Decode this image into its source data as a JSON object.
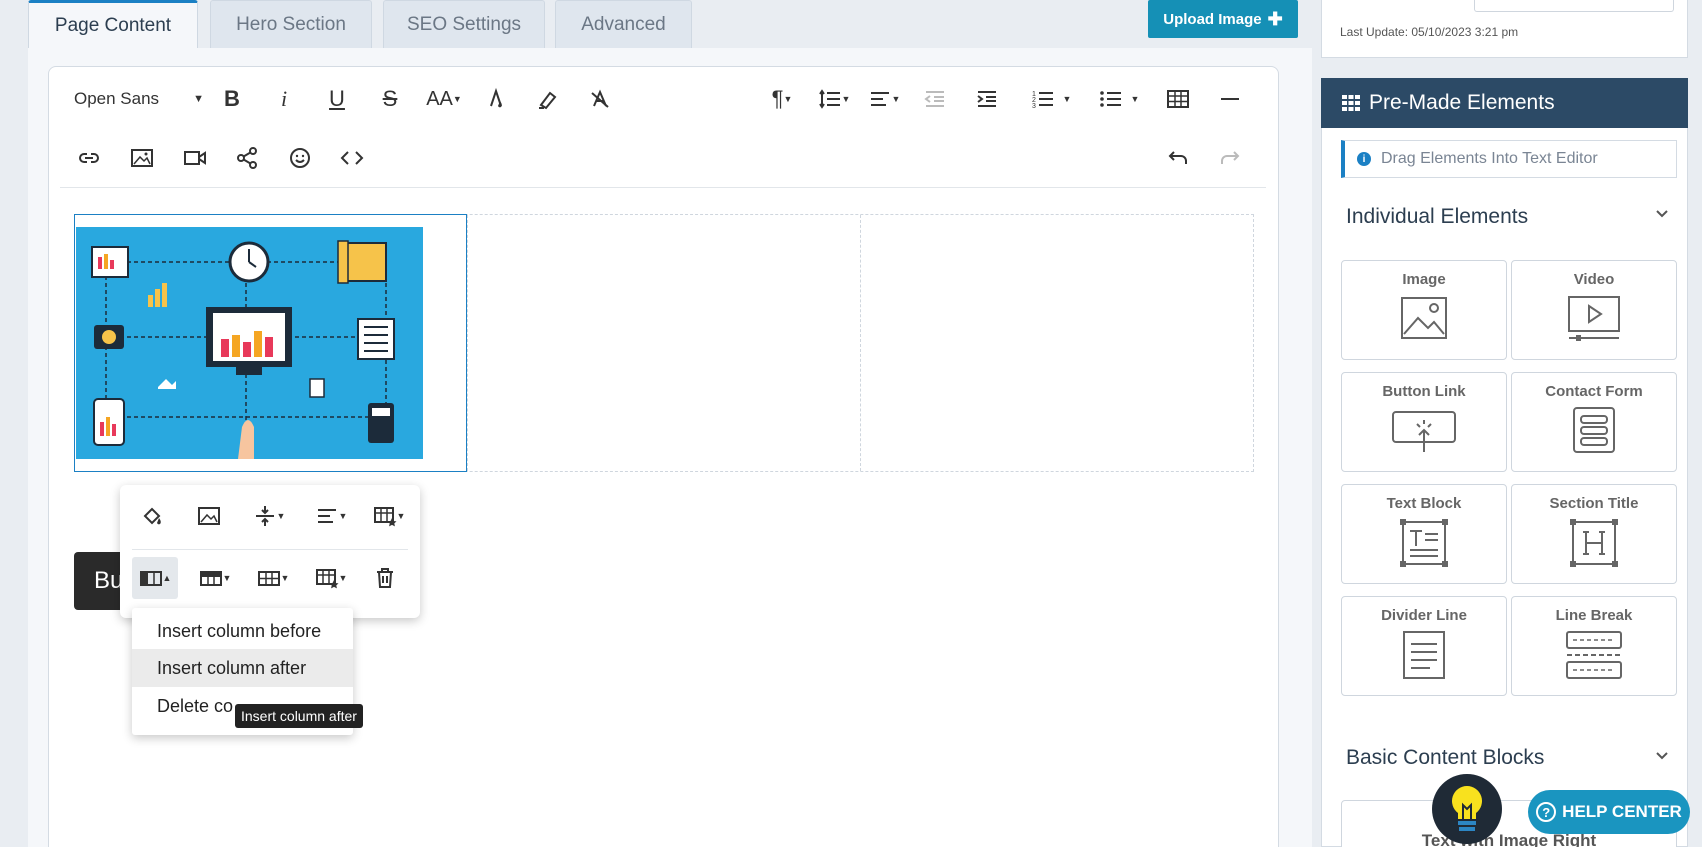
{
  "tabs": [
    {
      "label": "Page Content",
      "active": true
    },
    {
      "label": "Hero Section",
      "active": false
    },
    {
      "label": "SEO Settings",
      "active": false
    },
    {
      "label": "Advanced",
      "active": false
    }
  ],
  "upload_button": {
    "label": "Upload Image",
    "icon": "plus-icon"
  },
  "toolbar": {
    "font_family": "Open Sans",
    "aa_label": "AA"
  },
  "content": {
    "button_partial_text": "Bu"
  },
  "table_popup": {
    "dropdown_items": [
      "Insert column before",
      "Insert column after",
      "Delete co"
    ],
    "hovered_item": "Insert column after",
    "tooltip": "Insert column after"
  },
  "sidebar": {
    "last_update": "Last Update: 05/10/2023 3:21 pm",
    "premade_title": "Pre-Made Elements",
    "drag_note": "Drag Elements Into Text Editor",
    "individual_title": "Individual Elements",
    "elements": [
      {
        "label": "Image",
        "icon": "image-icon"
      },
      {
        "label": "Video",
        "icon": "video-icon"
      },
      {
        "label": "Button Link",
        "icon": "button-link-icon"
      },
      {
        "label": "Contact Form",
        "icon": "contact-form-icon"
      },
      {
        "label": "Text Block",
        "icon": "text-block-icon"
      },
      {
        "label": "Section Title",
        "icon": "section-title-icon"
      },
      {
        "label": "Divider Line",
        "icon": "divider-line-icon"
      },
      {
        "label": "Line Break",
        "icon": "line-break-icon"
      }
    ],
    "basic_title": "Basic Content Blocks",
    "next_card_text": "Text with Image Right"
  },
  "help": {
    "label": "HELP CENTER"
  },
  "colors": {
    "accent": "#1b80c4",
    "header": "#2c4a66",
    "help": "#1a95c0",
    "illustration_bg": "#29a8df"
  }
}
